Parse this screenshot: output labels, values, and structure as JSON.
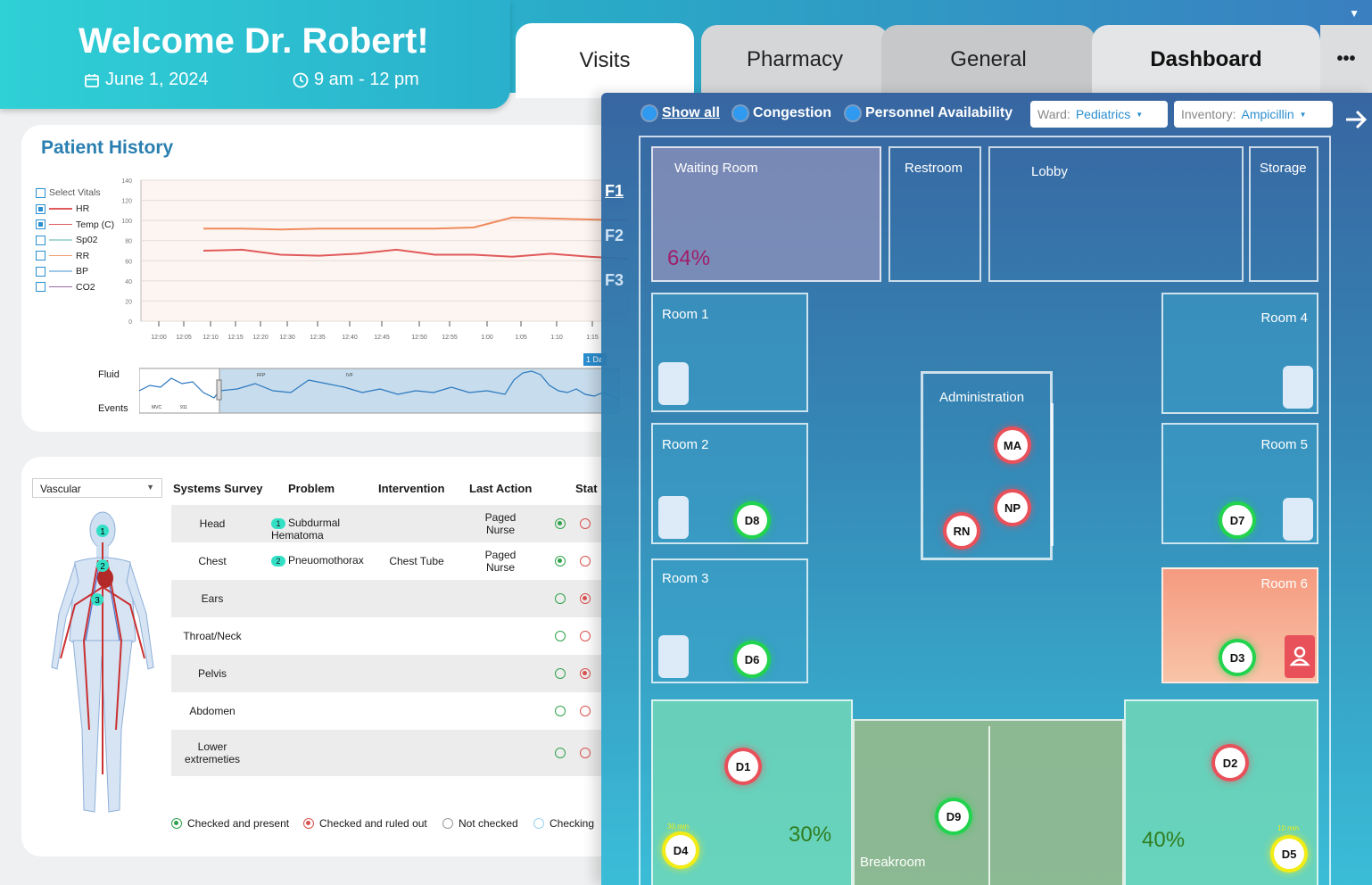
{
  "header": {
    "welcome": "Welcome Dr. Robert!",
    "date": "June 1, 2024",
    "time": "9 am - 12 pm",
    "tabs": [
      "Visits",
      "Pharmacy",
      "General",
      "Dashboard"
    ],
    "more": "•••"
  },
  "patient_history": {
    "title": "Patient History",
    "vitals_header": "Select Vitals",
    "vitals": [
      {
        "label": "HR",
        "checked": true,
        "color": "#e05a5a"
      },
      {
        "label": "Temp (C)",
        "checked": true,
        "color": "#e05a5a"
      },
      {
        "label": "Sp02",
        "checked": false,
        "color": "#a8d8d0"
      },
      {
        "label": "RR",
        "checked": false,
        "color": "#f0a070"
      },
      {
        "label": "BP",
        "checked": false,
        "color": "#a0c8e8"
      },
      {
        "label": "CO2",
        "checked": false,
        "color": "#9a6aa8"
      }
    ],
    "y_ticks": [
      "140",
      "120",
      "100",
      "80",
      "60",
      "40",
      "20",
      "0"
    ],
    "x_ticks": [
      "12:00",
      "12:05",
      "12:10",
      "12:15",
      "12:20",
      "12:30",
      "12:35",
      "12:40",
      "12:45",
      "12:50",
      "12:55",
      "1:00",
      "1:05",
      "1:10",
      "1:15"
    ],
    "fluid_label": "Fluid",
    "events_label": "Events",
    "event_marks": [
      "FFP",
      "IVF",
      "MVC",
      "911"
    ],
    "range_tag": "1 Da"
  },
  "chart_data": {
    "type": "line",
    "x": [
      "12:00",
      "12:05",
      "12:10",
      "12:15",
      "12:20",
      "12:30",
      "12:35",
      "12:40",
      "12:45",
      "12:50",
      "12:55",
      "1:00",
      "1:05",
      "1:10",
      "1:15"
    ],
    "ylim": [
      0,
      140
    ],
    "series": [
      {
        "name": "Temp (C)",
        "color": "#f08a5d",
        "values": [
          null,
          null,
          null,
          null,
          92,
          92,
          91,
          92,
          92,
          92,
          92,
          93,
          103,
          102,
          101,
          100
        ]
      },
      {
        "name": "HR",
        "color": "#e05a5a",
        "values": [
          null,
          null,
          null,
          null,
          70,
          71,
          66,
          65,
          67,
          71,
          66,
          66,
          64,
          67,
          64,
          62
        ]
      }
    ]
  },
  "systems_survey": {
    "select": "Vascular",
    "headers": [
      "Systems Survey",
      "Problem",
      "Intervention",
      "Last Action",
      "Stat"
    ],
    "rows": [
      {
        "system": "Head",
        "badge": "1",
        "problem": "Subdurmal Hematoma",
        "intervention": "",
        "last_action": "Paged Nurse",
        "green": "filled",
        "red": "empty"
      },
      {
        "system": "Chest",
        "badge": "2",
        "problem": "Pneuomothorax",
        "intervention": "Chest Tube",
        "last_action": "Paged Nurse",
        "green": "filled",
        "red": "empty"
      },
      {
        "system": "Ears",
        "badge": "",
        "problem": "",
        "intervention": "",
        "last_action": "",
        "green": "empty",
        "red": "filled"
      },
      {
        "system": "Throat/Neck",
        "badge": "",
        "problem": "",
        "intervention": "",
        "last_action": "",
        "green": "empty",
        "red": "empty"
      },
      {
        "system": "Pelvis",
        "badge": "",
        "problem": "",
        "intervention": "",
        "last_action": "",
        "green": "empty",
        "red": "filled"
      },
      {
        "system": "Abdomen",
        "badge": "",
        "problem": "",
        "intervention": "",
        "last_action": "",
        "green": "empty",
        "red": "empty"
      },
      {
        "system": "Lower extremeties",
        "badge": "",
        "problem": "",
        "intervention": "",
        "last_action": "",
        "green": "empty",
        "red": "empty"
      }
    ],
    "body_markers": [
      "1",
      "2",
      "3"
    ],
    "legend": [
      "Checked and present",
      "Checked and ruled out",
      "Not checked",
      "Checking"
    ]
  },
  "map": {
    "filters": [
      "Show all",
      "Congestion",
      "Personnel Availability"
    ],
    "ward_label": "Ward:",
    "ward_value": "Pediatrics",
    "inventory_label": "Inventory:",
    "inventory_value": "Ampicillin",
    "floors": [
      "F1",
      "F2",
      "F3"
    ],
    "rooms": {
      "waiting": "Waiting Room",
      "restroom": "Restroom",
      "lobby": "Lobby",
      "storage": "Storage",
      "room1": "Room 1",
      "room2": "Room 2",
      "room3": "Room 3",
      "room4": "Room 4",
      "room5": "Room 5",
      "room6": "Room 6",
      "admin": "Administration",
      "breakroom": "Breakroom"
    },
    "waiting_pct": "64%",
    "left_pct": "30%",
    "right_pct": "40%",
    "pins": {
      "ma": "MA",
      "np": "NP",
      "rn": "RN",
      "d1": "D1",
      "d2": "D2",
      "d3": "D3",
      "d4": "D4",
      "d5": "D5",
      "d6": "D6",
      "d7": "D7",
      "d8": "D8",
      "d9": "D9"
    },
    "timers": {
      "d4": "30 min",
      "d5": "10 min"
    }
  }
}
